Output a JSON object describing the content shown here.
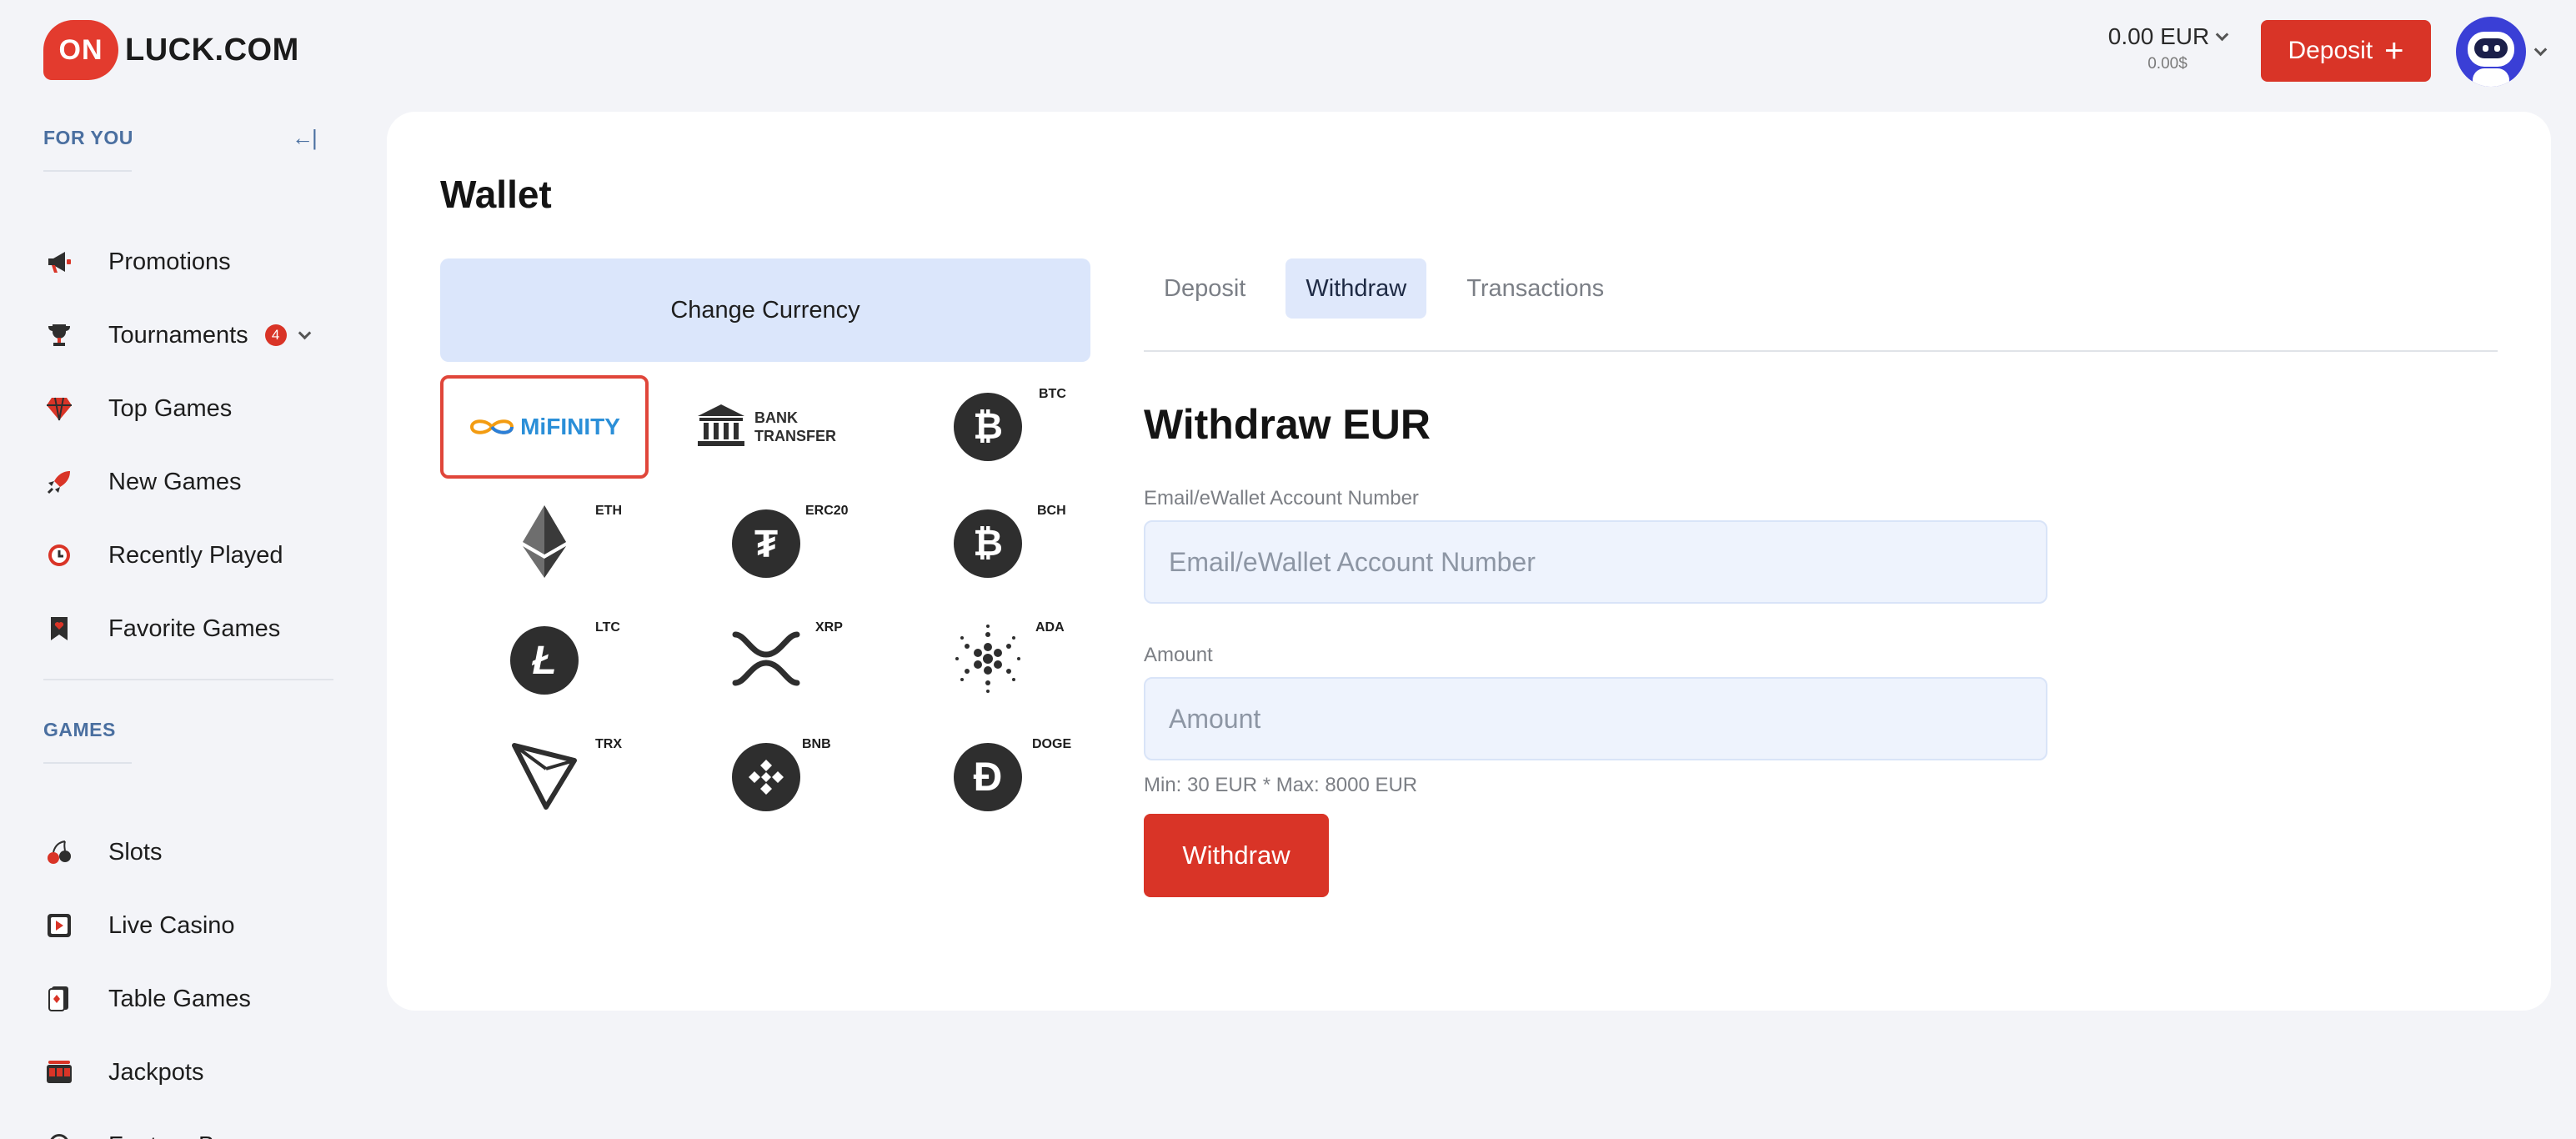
{
  "brand": {
    "logo_badge": "ON",
    "logo_text": "LUCK.COM"
  },
  "header": {
    "balance": "0.00 EUR",
    "balance_usd": "0.00$",
    "deposit_label": "Deposit",
    "deposit_icon": "plus-icon"
  },
  "sidebar": {
    "for_you_title": "FOR YOU",
    "games_title": "GAMES",
    "for_you_items": [
      {
        "label": "Promotions",
        "icon": "megaphone-icon"
      },
      {
        "label": "Tournaments",
        "icon": "trophy-icon",
        "badge": "4"
      },
      {
        "label": "Top Games",
        "icon": "diamond-icon"
      },
      {
        "label": "New Games",
        "icon": "rocket-icon"
      },
      {
        "label": "Recently Played",
        "icon": "clock-icon"
      },
      {
        "label": "Favorite Games",
        "icon": "heart-bookmark-icon"
      }
    ],
    "games_items": [
      {
        "label": "Slots",
        "icon": "cherries-icon"
      },
      {
        "label": "Live Casino",
        "icon": "play-icon"
      },
      {
        "label": "Table Games",
        "icon": "cards-icon"
      },
      {
        "label": "Jackpots",
        "icon": "slot-machine-icon"
      },
      {
        "label": "Feature Buy",
        "icon": "star-badge-icon"
      }
    ]
  },
  "wallet": {
    "title": "Wallet",
    "change_currency": "Change Currency",
    "methods": [
      {
        "name": "MiFINITY",
        "tag": "",
        "selected": true
      },
      {
        "name": "BANK TRANSFER",
        "tag": ""
      },
      {
        "name": "BTC",
        "tag": "BTC"
      },
      {
        "name": "ETH",
        "tag": "ETH"
      },
      {
        "name": "ERC20",
        "tag": "ERC20"
      },
      {
        "name": "BCH",
        "tag": "BCH"
      },
      {
        "name": "LTC",
        "tag": "LTC"
      },
      {
        "name": "XRP",
        "tag": "XRP"
      },
      {
        "name": "ADA",
        "tag": "ADA"
      },
      {
        "name": "TRX",
        "tag": "TRX"
      },
      {
        "name": "BNB",
        "tag": "BNB"
      },
      {
        "name": "DOGE",
        "tag": "DOGE"
      }
    ],
    "bank_line1": "BANK",
    "bank_line2": "TRANSFER",
    "mifinity_text": "MiFINITY",
    "tabs": [
      {
        "label": "Deposit",
        "active": false
      },
      {
        "label": "Withdraw",
        "active": true
      },
      {
        "label": "Transactions",
        "active": false
      }
    ],
    "form": {
      "heading": "Withdraw EUR",
      "account_label": "Email/eWallet Account Number",
      "account_placeholder": "Email/eWallet Account Number",
      "amount_label": "Amount",
      "amount_placeholder": "Amount",
      "limits": "Min: 30 EUR * Max: 8000 EUR",
      "submit": "Withdraw"
    }
  },
  "colors": {
    "accent": "#d93427",
    "link": "#4a6fa0",
    "tab_active_bg": "#dfe8fb",
    "field_bg": "#eef3fd"
  }
}
